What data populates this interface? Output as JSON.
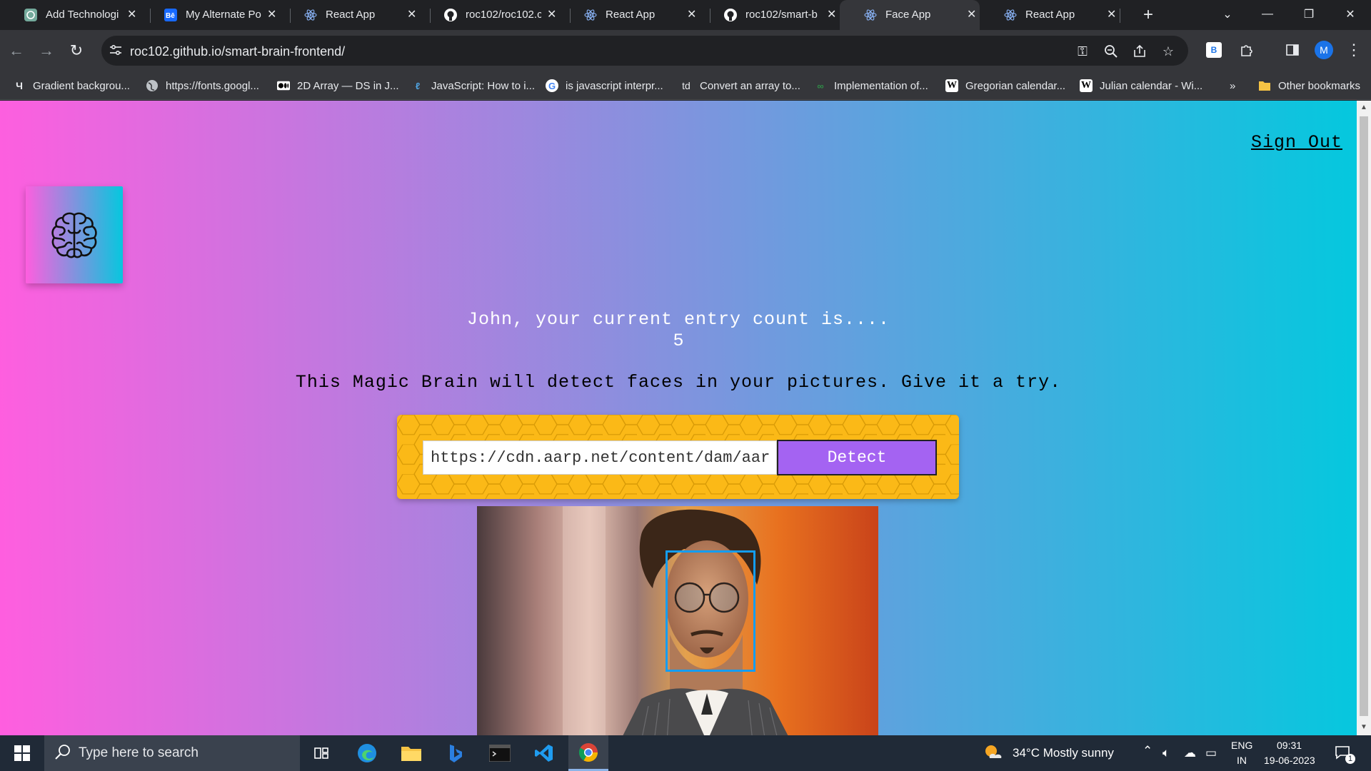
{
  "browser": {
    "tabs": [
      {
        "title": "Add Technologi",
        "icon": "chatgpt-icon"
      },
      {
        "title": "My Alternate Po",
        "icon": "behance-icon"
      },
      {
        "title": "React App",
        "icon": "react-icon"
      },
      {
        "title": "roc102/roc102.c",
        "icon": "github-icon"
      },
      {
        "title": "React App",
        "icon": "react-icon"
      },
      {
        "title": "roc102/smart-b",
        "icon": "github-icon"
      },
      {
        "title": "Face App",
        "icon": "react-icon",
        "active": true
      },
      {
        "title": "React App",
        "icon": "react-icon"
      }
    ],
    "url": "roc102.github.io/smart-brain-frontend/",
    "profile_initial": "M",
    "extension_label": "B",
    "bookmarks": [
      {
        "label": "Gradient backgrou...",
        "icon": "uh-icon"
      },
      {
        "label": "https://fonts.googl...",
        "icon": "globe-icon"
      },
      {
        "label": "2D Array — DS in J...",
        "icon": "medium-icon"
      },
      {
        "label": "JavaScript: How to i...",
        "icon": "link-icon"
      },
      {
        "label": "is javascript interpr...",
        "icon": "google-icon"
      },
      {
        "label": "Convert an array to...",
        "icon": "td-icon"
      },
      {
        "label": "Implementation of...",
        "icon": "gfg-icon"
      },
      {
        "label": "Gregorian calendar...",
        "icon": "wikipedia-icon"
      },
      {
        "label": "Julian calendar - Wi...",
        "icon": "wikipedia-icon"
      }
    ],
    "bookmarks_overflow": "»",
    "other_bookmarks": "Other bookmarks"
  },
  "page": {
    "sign_out": "Sign Out",
    "rank_line": "John, your current entry count is....",
    "entry_count": "5",
    "tagline": "This Magic Brain will detect faces in your pictures. Give it a try.",
    "url_input_value": "https://cdn.aarp.net/content/dam/aarp",
    "detect_label": "Detect"
  },
  "taskbar": {
    "search_placeholder": "Type here to search",
    "weather": "34°C  Mostly sunny",
    "lang_top": "ENG",
    "lang_bottom": "IN",
    "time": "09:31",
    "date": "19-06-2023",
    "notification_count": "1"
  },
  "colors": {
    "gradient_start": "#ff5edf",
    "gradient_end": "#04c8de",
    "panel_yellow": "#fbb917",
    "detect_purple": "#a463f2",
    "face_box_blue": "#149df2"
  }
}
